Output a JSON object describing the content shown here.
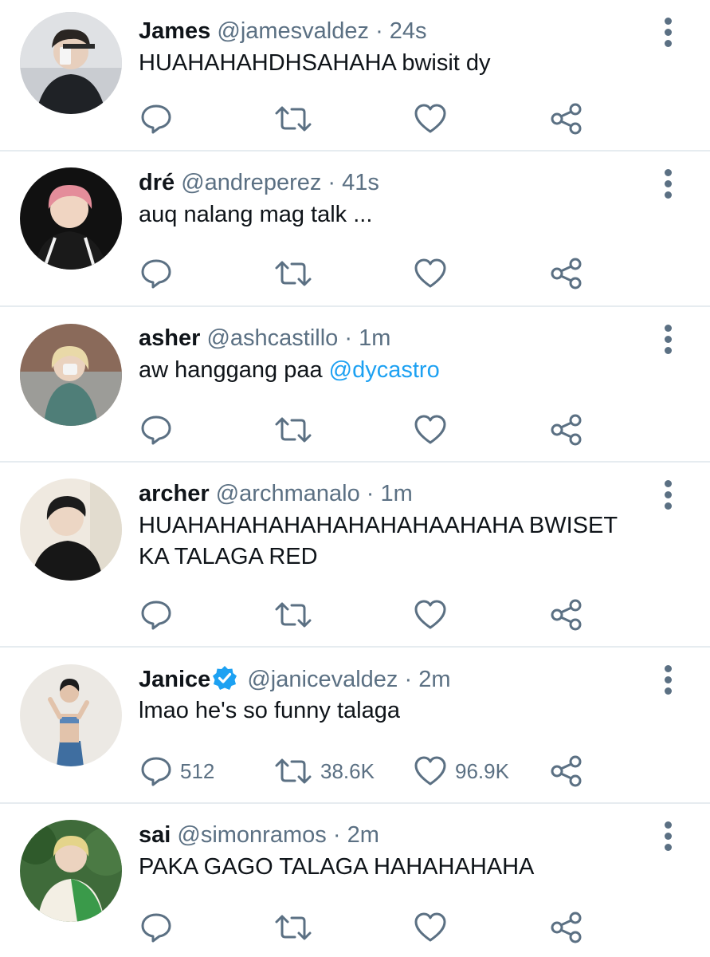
{
  "colors": {
    "text": "#0f1419",
    "secondary": "#5b7083",
    "accent": "#1da1f2",
    "divider": "#e6ecf0"
  },
  "icons": {
    "reply": "reply-icon",
    "retweet": "retweet-icon",
    "like": "heart-icon",
    "share": "share-icon",
    "more": "more-vertical-icon",
    "verified": "verified-badge-icon"
  },
  "tweets": [
    {
      "name": "James",
      "handle": "@jamesvaldez",
      "separator": "·",
      "time": "24s",
      "text": "HUAHAHAHDHSAHAHA bwisit dy",
      "verified": false,
      "counts": {
        "reply": "",
        "retweet": "",
        "like": ""
      }
    },
    {
      "name": "dré",
      "handle": "@andreperez",
      "separator": "·",
      "time": "41s",
      "text": "auq nalang mag talk ...",
      "verified": false,
      "counts": {
        "reply": "",
        "retweet": "",
        "like": ""
      }
    },
    {
      "name": "asher",
      "handle": "@ashcastillo",
      "separator": "·",
      "time": "1m",
      "text": "aw hanggang paa ",
      "mention": "@dycastro",
      "verified": false,
      "counts": {
        "reply": "",
        "retweet": "",
        "like": ""
      }
    },
    {
      "name": "archer",
      "handle": "@archmanalo",
      "separator": "·",
      "time": "1m",
      "text_line1": "HUAHAHAHAHAHAHAHAHAAHAHA BWISET",
      "text_line2": "KA TALAGA RED",
      "verified": false,
      "counts": {
        "reply": "",
        "retweet": "",
        "like": ""
      }
    },
    {
      "name": "Janice",
      "handle": "@janicevaldez",
      "separator": "·",
      "time": "2m",
      "text": "lmao he's so funny talaga",
      "verified": true,
      "counts": {
        "reply": "512",
        "retweet": "38.6K",
        "like": "96.9K"
      }
    },
    {
      "name": "sai",
      "handle": "@simonramos",
      "separator": "·",
      "time": "2m",
      "text": "PAKA GAGO TALAGA HAHAHAHAHA",
      "verified": false,
      "counts": {
        "reply": "",
        "retweet": "",
        "like": ""
      }
    }
  ]
}
